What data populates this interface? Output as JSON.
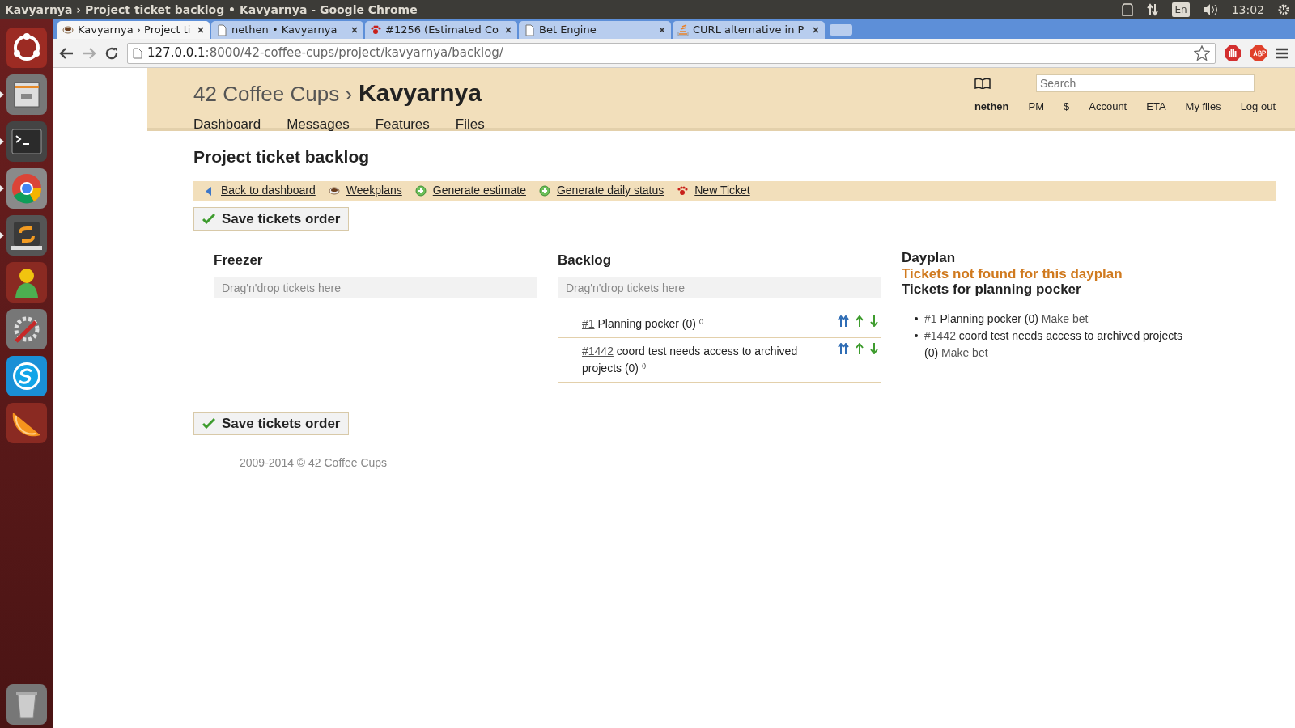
{
  "os_panel": {
    "title": "Kavyarnya › Project ticket backlog • Kavyarnya - Google Chrome",
    "keyboard": "En",
    "clock": "13:02"
  },
  "launcher": [
    {
      "kind": "dash",
      "running": false
    },
    {
      "kind": "files",
      "running": true
    },
    {
      "kind": "terminal",
      "running": true
    },
    {
      "kind": "chrome",
      "running": true
    },
    {
      "kind": "sublime",
      "running": true
    },
    {
      "kind": "person",
      "running": false
    },
    {
      "kind": "settings",
      "running": false
    },
    {
      "kind": "skype",
      "running": false
    },
    {
      "kind": "orange",
      "running": false
    },
    {
      "kind": "trash",
      "running": false
    }
  ],
  "browser": {
    "tabs": [
      {
        "kind": "cup",
        "title": "Kavyarnya › Project ti",
        "selected": true
      },
      {
        "kind": "page",
        "title": "nethen • Kavyarnya",
        "selected": false
      },
      {
        "kind": "paw",
        "title": "#1256 (Estimated Co",
        "selected": false
      },
      {
        "kind": "page",
        "title": "Bet Engine",
        "selected": false
      },
      {
        "kind": "stack",
        "title": "CURL alternative in P",
        "selected": false
      }
    ],
    "url_host": "127.0.0.1",
    "url_path": ":8000/42-coffee-cups/project/kavyarnya/backlog/"
  },
  "header": {
    "company": "42 Coffee Cups ›",
    "project": "Kavyarnya",
    "nav": [
      "Dashboard",
      "Messages",
      "Features",
      "Files"
    ],
    "search": {
      "placeholder": "Search"
    },
    "user_links": [
      {
        "label": "nethen",
        "kind": "user"
      },
      {
        "label": "PM",
        "kind": "link"
      },
      {
        "label": "$",
        "kind": "link"
      },
      {
        "label": "Account",
        "kind": "link"
      },
      {
        "label": "ETA",
        "kind": "link"
      },
      {
        "label": "My files",
        "kind": "link"
      },
      {
        "label": "Log out",
        "kind": "link"
      }
    ]
  },
  "page_title": "Project ticket backlog",
  "actions": [
    {
      "kind": "back",
      "label": "Back to dashboard"
    },
    {
      "kind": "cup",
      "label": "Weekplans"
    },
    {
      "kind": "plus",
      "label": "Generate estimate"
    },
    {
      "kind": "plus",
      "label": "Generate daily status"
    },
    {
      "kind": "paw",
      "label": "New Ticket"
    }
  ],
  "save_buttons": [
    "Save tickets order",
    "Save tickets order"
  ],
  "columns": [
    {
      "title": "Freezer",
      "drop_hint": "Drag'n'drop tickets here"
    },
    {
      "title": "Backlog",
      "drop_hint": "Drag'n'drop tickets here",
      "tickets": [
        {
          "number": "#1",
          "title": "Planning pocker (0)",
          "note": "()"
        },
        {
          "number": "#1442",
          "title": "coord test needs access to archived projects (0)",
          "note": "()"
        }
      ]
    }
  ],
  "dayplan": {
    "title": "Dayplan",
    "warning": "Tickets not found for this dayplan",
    "subtitle": "Tickets for planning pocker",
    "items": [
      {
        "number": "#1",
        "title": "Planning pocker (0)",
        "action": "Make bet"
      },
      {
        "number": "#1442",
        "title": "coord test needs access to archived projects (0)",
        "action": "Make bet"
      }
    ]
  },
  "footer": {
    "text": "2009-2014 ©",
    "link": "42 Coffee Cups"
  }
}
